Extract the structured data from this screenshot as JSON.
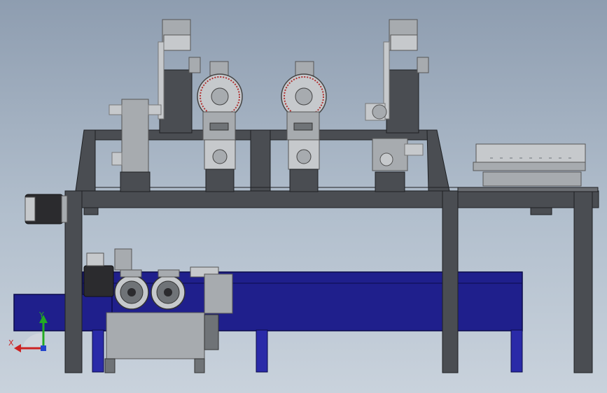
{
  "viewport": {
    "background_top": "#8e9db0",
    "background_bottom": "#c9d2dc"
  },
  "colors": {
    "frame": "#4a4d52",
    "frame_edge": "#1e2023",
    "machine": "#a7abaf",
    "machine_light": "#c6c9cc",
    "machine_dark": "#6f7377",
    "conveyor": "#1f1f8c",
    "conveyor_edge": "#0b0b4a",
    "conveyor_leg": "#2a2aa8",
    "motor_black": "#2b2b2e",
    "accent_red": "#b03030"
  },
  "triad": {
    "x_label": "X",
    "y_label": "Y",
    "x_color": "#cc2222",
    "y_color": "#22aa22",
    "z_color": "#2244cc",
    "icon": "coordinate-triad-icon"
  }
}
